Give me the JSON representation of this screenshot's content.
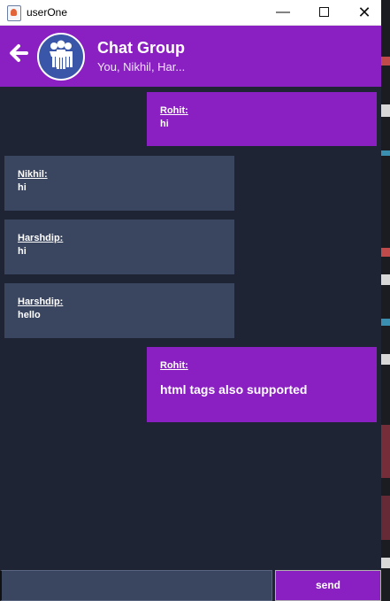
{
  "window": {
    "title": "userOne",
    "minimize_glyph": "—",
    "close_glyph": "✕"
  },
  "header": {
    "group_name": "Chat Group",
    "members": "You, Nikhil, Har...",
    "back_icon": "arrow-left-icon",
    "avatar_icon": "group-people-icon"
  },
  "messages": [
    {
      "sender": "Rohit:",
      "text": "hi",
      "mine": true
    },
    {
      "sender": "Nikhil:",
      "text": "hi",
      "mine": false
    },
    {
      "sender": "Harshdip:",
      "text": "hi",
      "mine": false
    },
    {
      "sender": "Harshdip:",
      "text": "hello",
      "mine": false
    },
    {
      "sender": "Rohit:",
      "text": "html tags also supported",
      "mine": true
    }
  ],
  "composer": {
    "input_value": "",
    "send_label": "send"
  },
  "colors": {
    "accent": "#8a1fc2",
    "background": "#1e2433",
    "incoming_bubble": "#3a4560"
  }
}
